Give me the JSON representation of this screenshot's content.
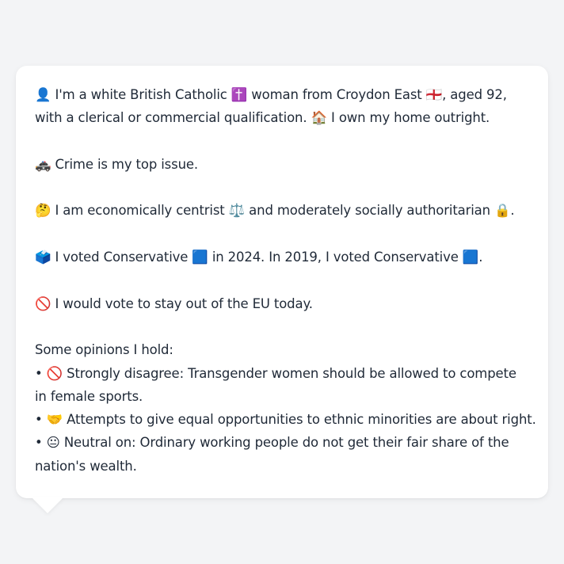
{
  "profile": {
    "line1": "👤 I'm a white British Catholic ✝️ woman from Croydon East 🏴󠁧󠁢󠁥󠁮󠁧󠁿, aged 92,",
    "line2": "with a clerical or commercial qualification. 🏠 I own my home outright.",
    "crime": "🚓 Crime is my top issue.",
    "ideology": "🤔 I am economically centrist ⚖️ and moderately socially authoritarian 🔒.",
    "vote": "🗳️ I voted Conservative 🟦 in 2024. In 2019, I voted Conservative 🟦.",
    "eu": "🚫 I would vote to stay out of the EU today."
  },
  "opinions": {
    "heading": "Some opinions I hold:",
    "items": [
      {
        "line1": "• 🚫 Strongly disagree: Transgender women should be allowed to compete",
        "line2": "in female sports."
      },
      {
        "line1": "• 🤝 Attempts to give equal opportunities to ethnic minorities are about right."
      },
      {
        "line1": "• 😐 Neutral on: Ordinary working people do not get their fair share of the",
        "line2": "nation's wealth."
      }
    ]
  }
}
